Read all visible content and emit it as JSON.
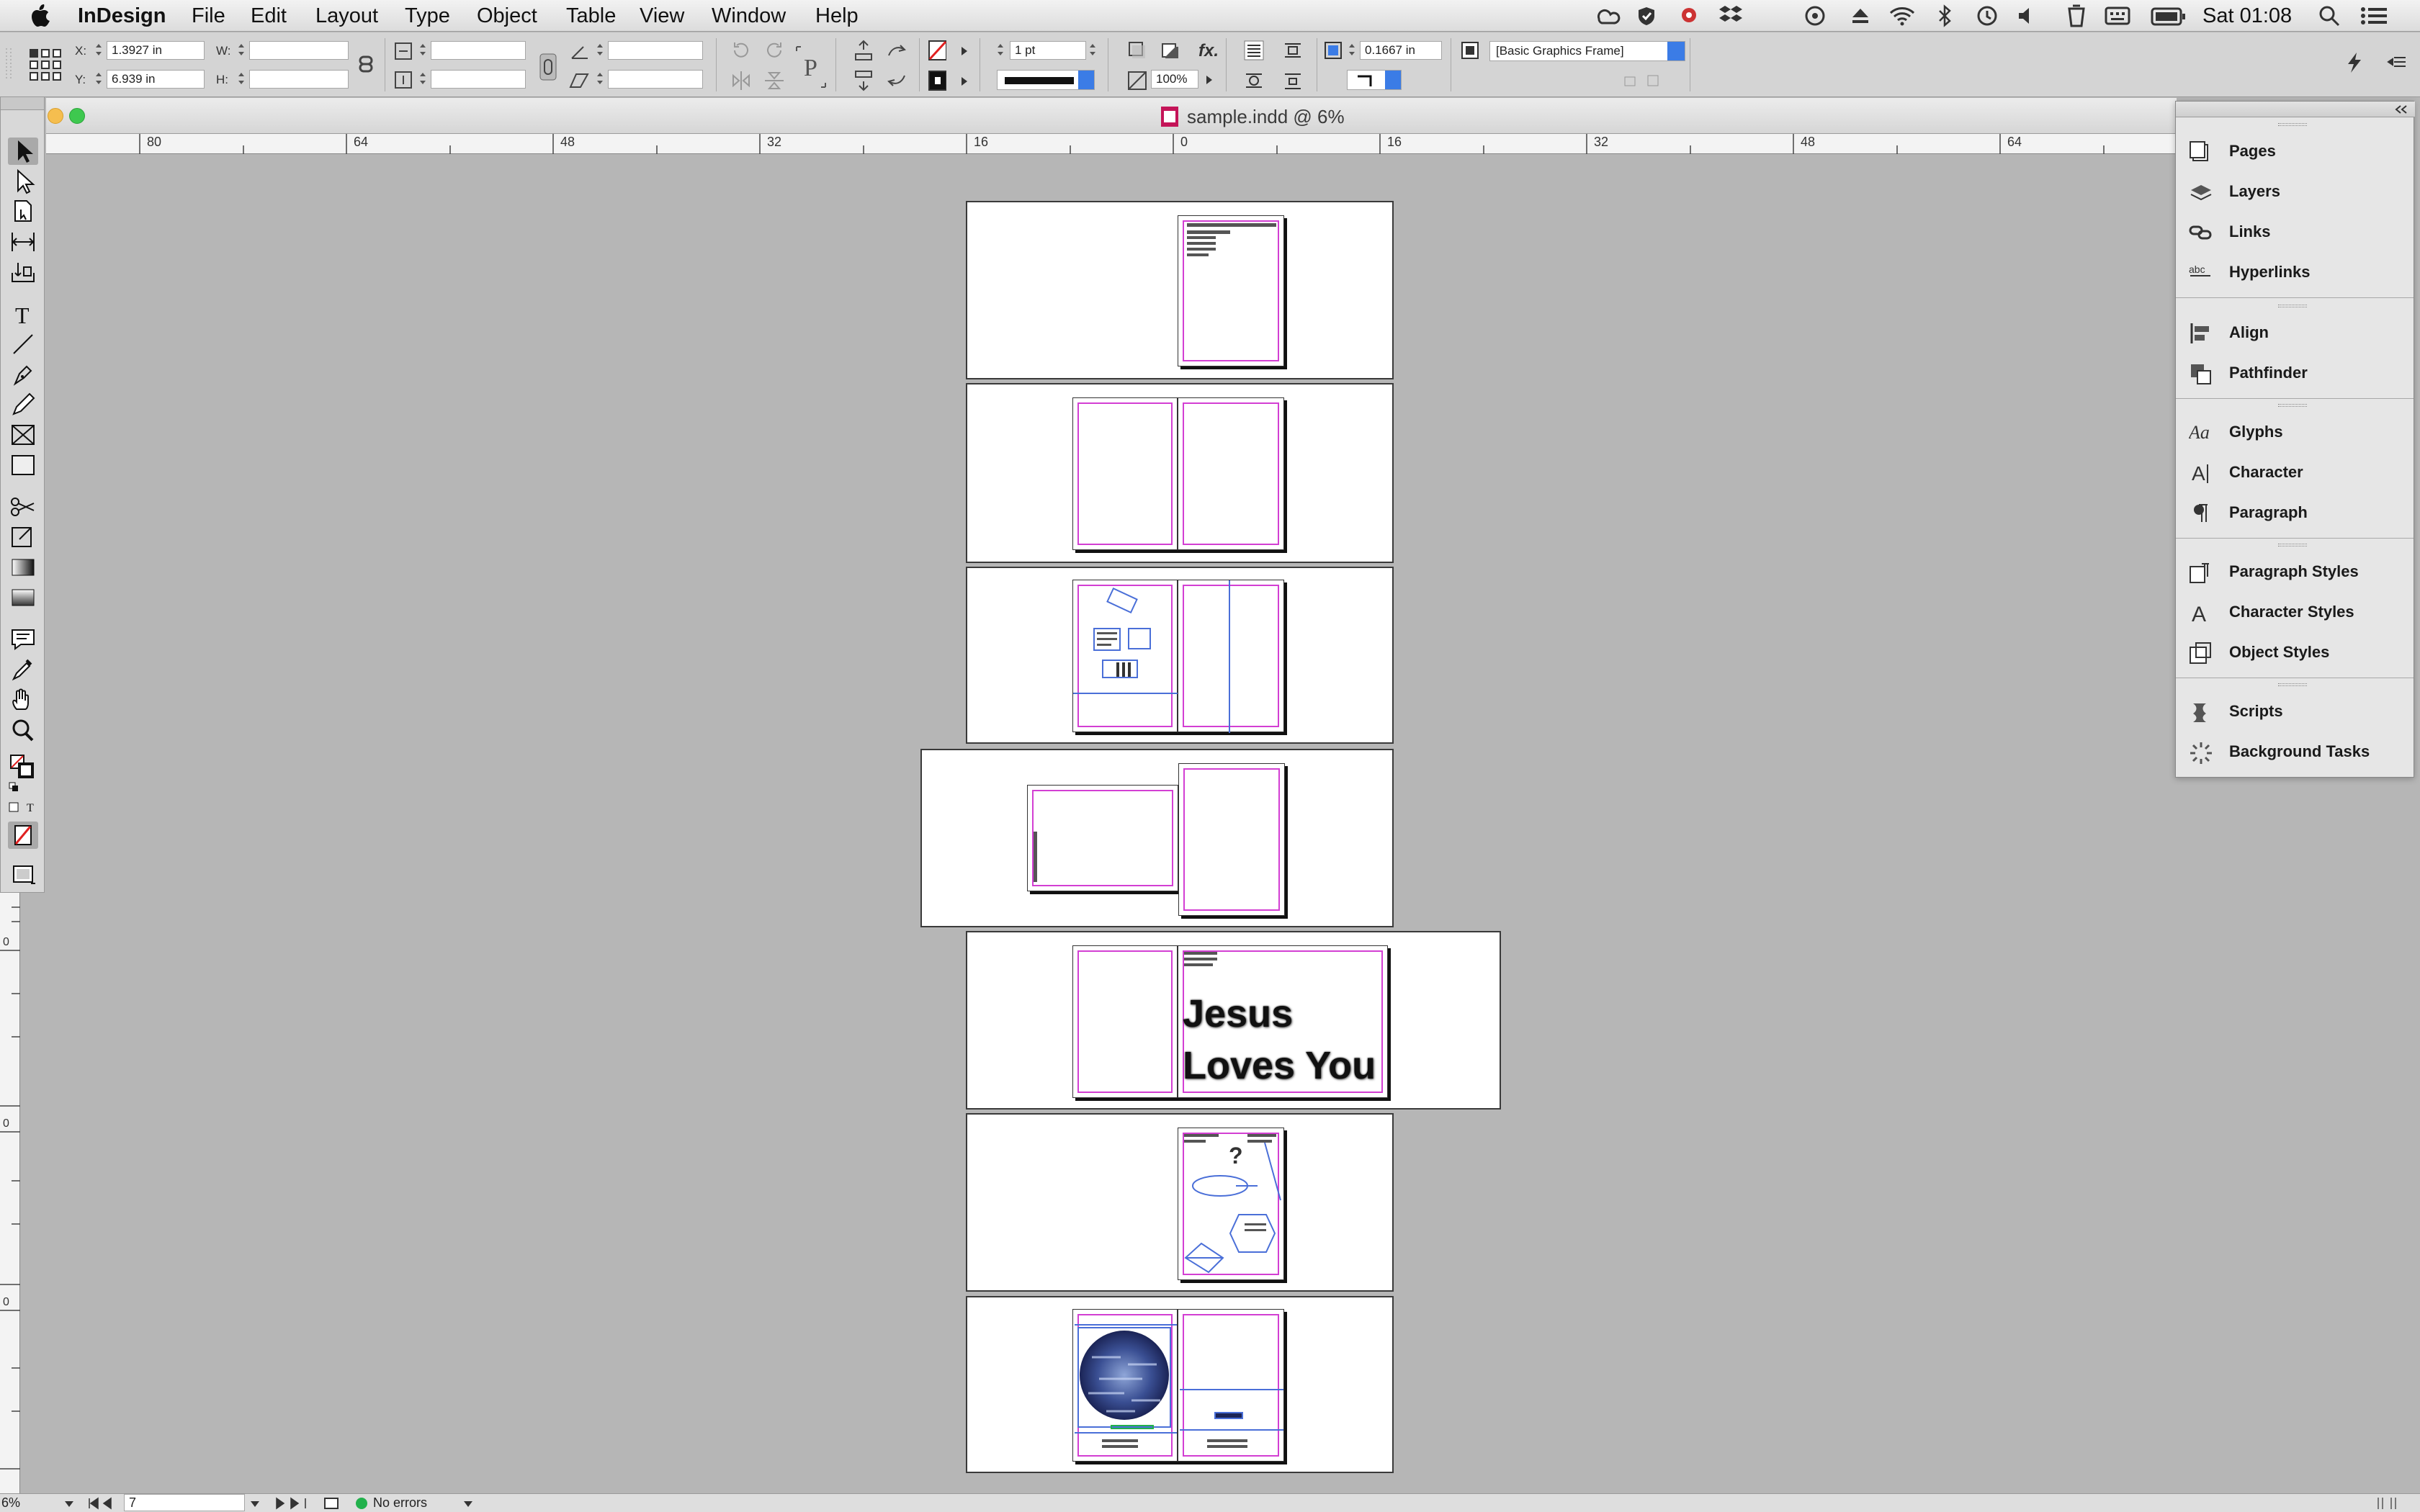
{
  "menubar": {
    "app": "InDesign",
    "items": [
      "File",
      "Edit",
      "Layout",
      "Type",
      "Object",
      "Table",
      "View",
      "Window",
      "Help"
    ],
    "clock": "Sat 01:08"
  },
  "control": {
    "x_label": "X:",
    "x_value": "1.3927 in",
    "y_label": "Y:",
    "y_value": "6.939 in",
    "w_label": "W:",
    "h_label": "H:",
    "stroke_weight": "1 pt",
    "opacity": "100%",
    "fx_label": "fx.",
    "offset": "0.1667 in",
    "object_style": "[Basic Graphics Frame]"
  },
  "document": {
    "title": "sample.indd @ 6%"
  },
  "ruler": {
    "ticks": [
      "80",
      "64",
      "48",
      "32",
      "16",
      "0",
      "16",
      "32",
      "48",
      "64"
    ]
  },
  "vruler": {
    "ticks": [
      "0",
      "0",
      "0"
    ]
  },
  "spread5": {
    "line1": "Jesus",
    "line2": "Loves You"
  },
  "spread6": {
    "mark": "?"
  },
  "panel": {
    "groups": [
      [
        "Pages",
        "Layers",
        "Links",
        "Hyperlinks"
      ],
      [
        "Align",
        "Pathfinder"
      ],
      [
        "Glyphs",
        "Character",
        "Paragraph"
      ],
      [
        "Paragraph Styles",
        "Character Styles",
        "Object Styles"
      ],
      [
        "Scripts",
        "Background Tasks"
      ]
    ]
  },
  "status": {
    "zoom": "6%",
    "page": "7",
    "preflight": "No errors"
  },
  "colors": {
    "margin": "#d33fd3",
    "column": "#4a6fd8",
    "pasteboard": "#b6b6b6",
    "preflight_ok": "#22b14c"
  }
}
